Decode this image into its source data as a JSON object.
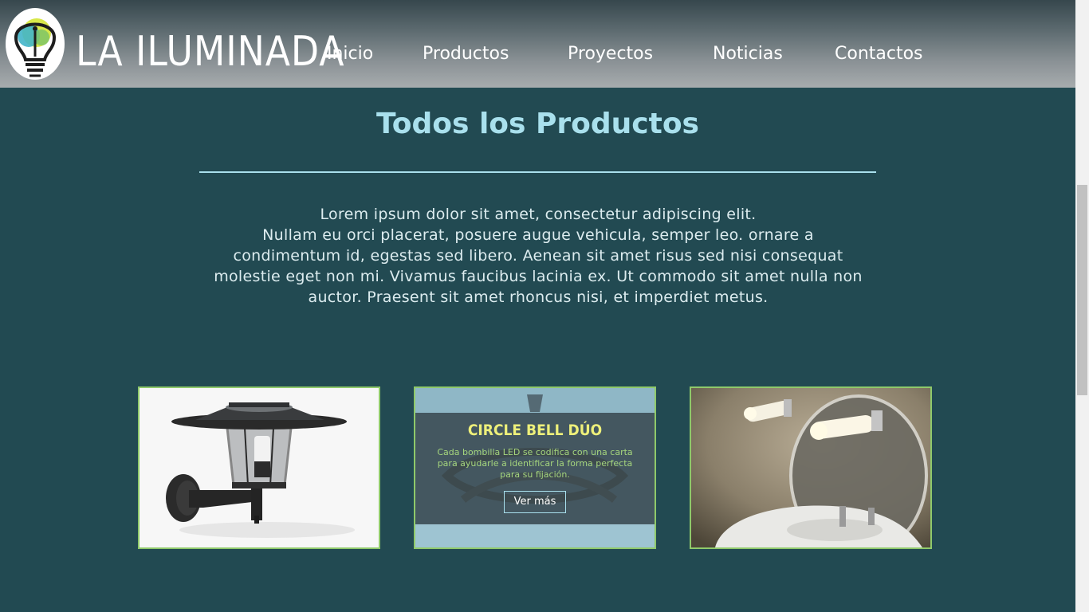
{
  "brand": {
    "name": "LA ILUMINADA",
    "logo_icon": "lightbulb-logo-icon"
  },
  "nav": {
    "items": [
      {
        "label": "Inicio"
      },
      {
        "label": "Productos"
      },
      {
        "label": "Proyectos"
      },
      {
        "label": "Noticias"
      },
      {
        "label": "Contactos"
      }
    ]
  },
  "main": {
    "title": "Todos los Productos",
    "intro_lines": [
      "Lorem ipsum dolor sit amet, consectetur adipiscing elit.",
      "Nullam eu orci placerat, posuere augue vehicula, semper leo. ornare a",
      "condimentum id, egestas sed libero. Aenean sit amet risus sed nisi consequat",
      "molestie eget non mi. Vivamus faucibus lacinia ex. Ut commodo sit amet nulla non",
      "auctor. Praesent sit amet rhoncus nisi, et imperdiet metus."
    ]
  },
  "products": [
    {
      "image": "outdoor-wall-lantern-image"
    },
    {
      "image": "circle-bell-duo-image",
      "overlay_title": "CIRCLE BELL DÚO",
      "overlay_desc": "Cada bombilla LED se codifica con una carta para ayudarle a identificar la forma perfecta para su fijación.",
      "button_label": "Ver más"
    },
    {
      "image": "bathroom-mirror-lights-image"
    }
  ],
  "colors": {
    "background": "#224a52",
    "title": "#a9e0ed",
    "card_border": "#8fc96a",
    "overlay_title": "#eef07a",
    "overlay_text": "#a5d57d"
  }
}
